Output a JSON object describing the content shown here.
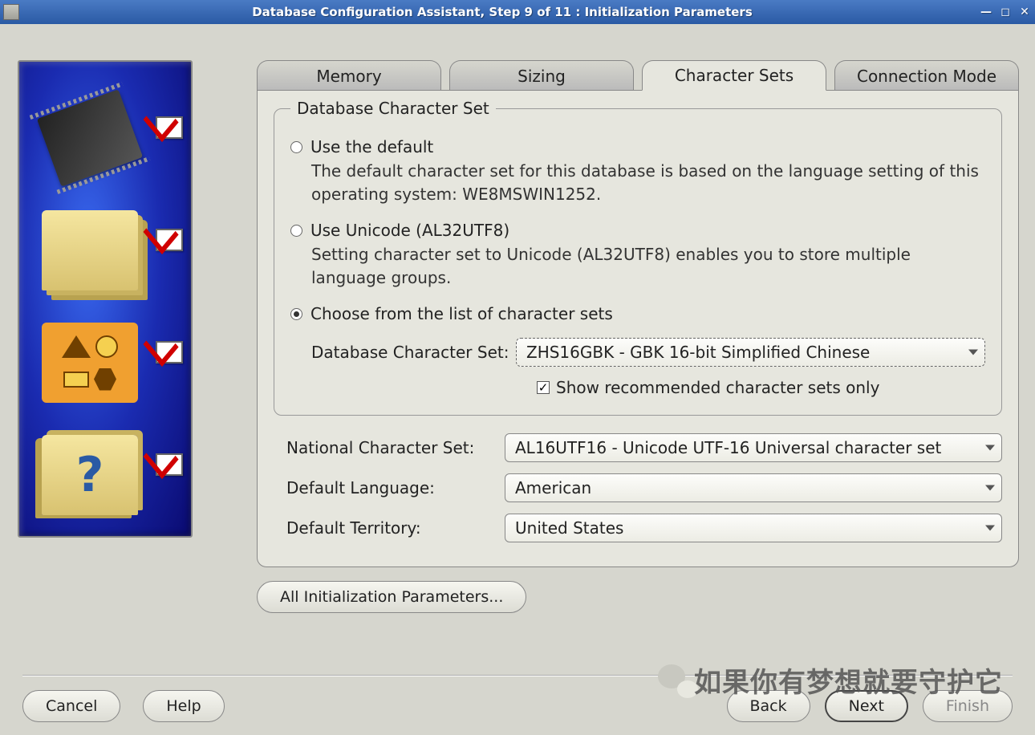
{
  "window": {
    "title": "Database Configuration Assistant, Step 9 of 11 : Initialization Parameters"
  },
  "tabs": {
    "memory": "Memory",
    "sizing": "Sizing",
    "charsets": "Character Sets",
    "connmode": "Connection Mode"
  },
  "group": {
    "legend": "Database Character Set",
    "opt_default_label": "Use the default",
    "opt_default_desc": "The default character set for this database is based on the language setting of this operating system: WE8MSWIN1252.",
    "opt_unicode_label": "Use Unicode (AL32UTF8)",
    "opt_unicode_desc": "Setting character set to Unicode (AL32UTF8) enables you to store multiple language groups.",
    "opt_choose_label": "Choose from the list of character sets",
    "dbcharset_label": "Database Character Set:",
    "dbcharset_value": "ZHS16GBK - GBK 16-bit Simplified Chinese",
    "show_recommended_label": "Show recommended character sets only"
  },
  "fields": {
    "national_label": "National Character Set:",
    "national_value": "AL16UTF16 - Unicode UTF-16 Universal character set",
    "language_label": "Default Language:",
    "language_value": "American",
    "territory_label": "Default Territory:",
    "territory_value": "United States"
  },
  "buttons": {
    "all_init": "All Initialization Parameters...",
    "cancel": "Cancel",
    "help": "Help",
    "back": "Back",
    "next": "Next",
    "finish": "Finish"
  },
  "watermark": "如果你有梦想就要守护它"
}
